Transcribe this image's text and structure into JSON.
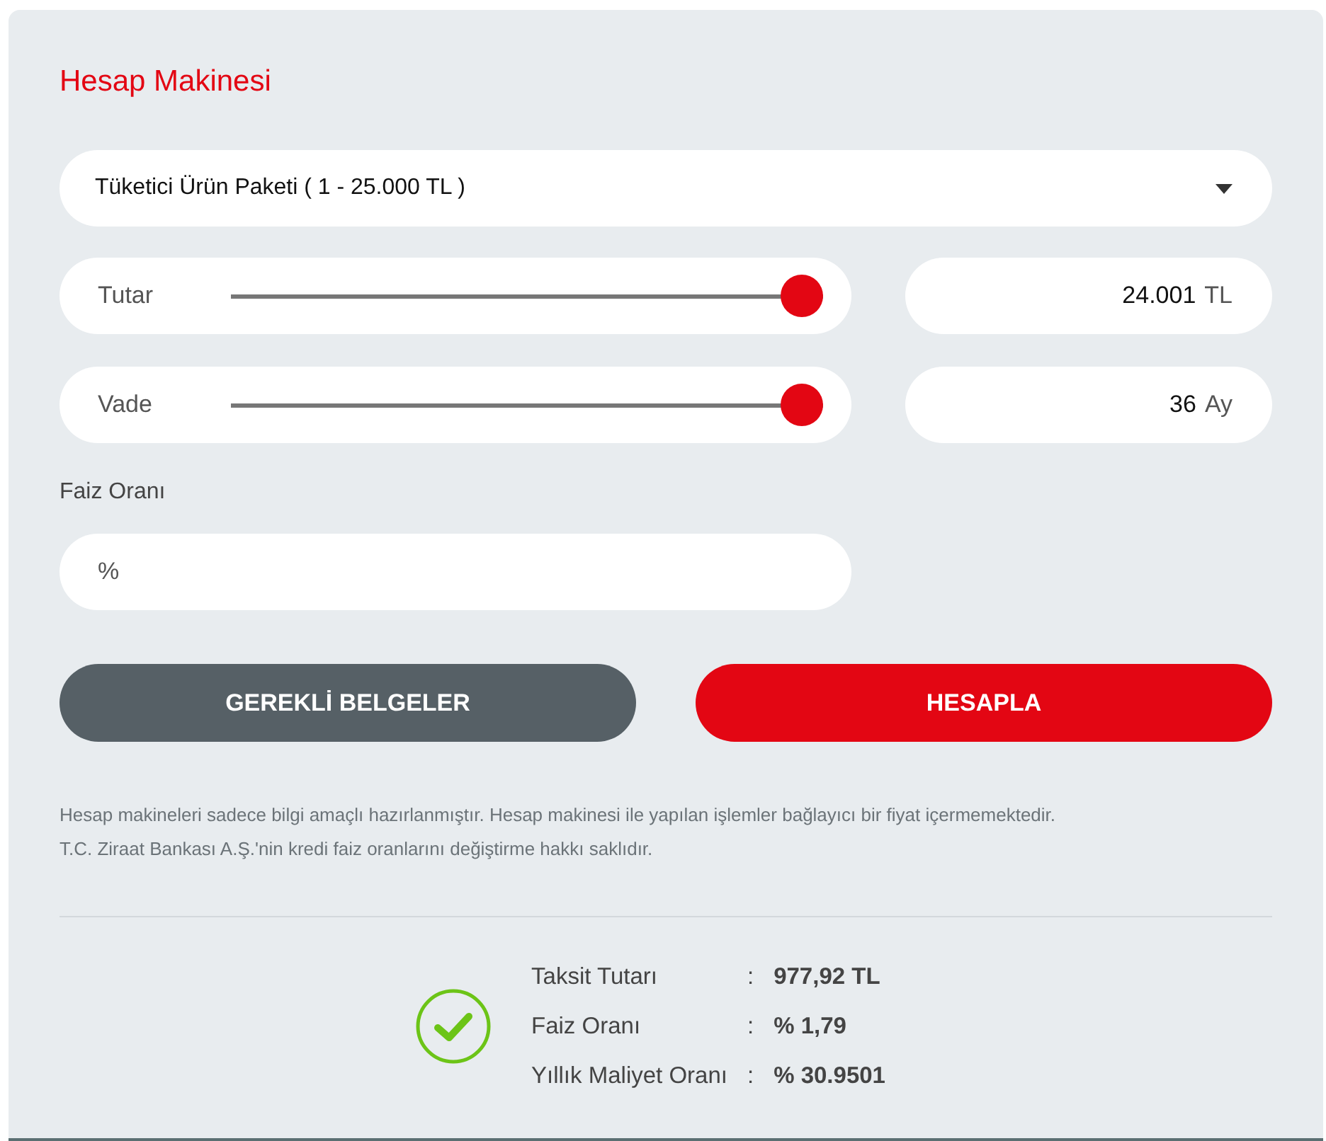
{
  "title": "Hesap Makinesi",
  "product_select": {
    "value": "Tüketici Ürün Paketi ( 1 - 25.000 TL )"
  },
  "sliders": [
    {
      "label": "Tutar",
      "level": 1,
      "value": "24.001",
      "unit": "TL"
    },
    {
      "label": "Vade",
      "level": 1,
      "value": "36",
      "unit": "Ay"
    }
  ],
  "interest": {
    "label": "Faiz Oranı",
    "placeholder": "%"
  },
  "buttons": [
    {
      "label": "GEREKLİ BELGELER",
      "kind": "secondary"
    },
    {
      "label": "HESAPLA",
      "kind": "primary"
    }
  ],
  "disclaimer": [
    "Hesap makineleri sadece bilgi amaçlı hazırlanmıştır. Hesap makinesi ile yapılan işlemler bağlayıcı bir fiyat içermemektedir.",
    "T.C. Ziraat Bankası A.Ş.'nin kredi faiz oranlarını değiştirme hakkı saklıdır."
  ],
  "results": [
    {
      "label": "Taksit Tutarı",
      "separator": ":",
      "value": "977,92 TL"
    },
    {
      "label": "Faiz Oranı",
      "separator": ":",
      "value": "% 1,79"
    },
    {
      "label": "Yıllık Maliyet Oranı",
      "separator": ":",
      "value": "% 30.9501"
    }
  ]
}
